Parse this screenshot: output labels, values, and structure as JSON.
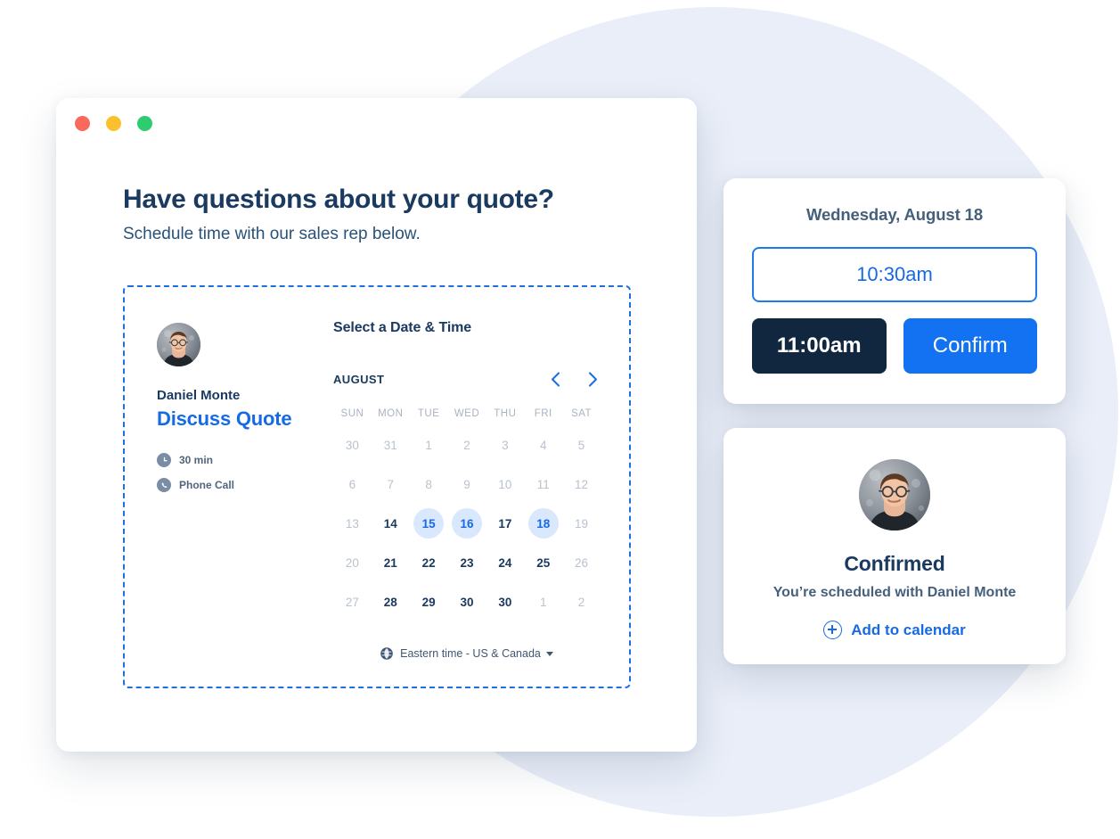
{
  "window": {
    "dots": [
      "close-red",
      "minimize-yellow",
      "maximize-green"
    ]
  },
  "header": {
    "title": "Have questions about your quote?",
    "subtitle": "Schedule time with our sales rep below."
  },
  "scheduler": {
    "rep": {
      "name": "Daniel Monte",
      "meeting_title": "Discuss Quote",
      "meta": [
        {
          "icon": "clock-icon",
          "label": "30 min"
        },
        {
          "icon": "phone-icon",
          "label": "Phone Call"
        }
      ]
    },
    "calendar": {
      "heading": "Select a Date & Time",
      "month": "AUGUST",
      "prev_arrow": "chevron-left-icon",
      "next_arrow": "chevron-right-icon",
      "weekdays": [
        "SUN",
        "MON",
        "TUE",
        "WED",
        "THU",
        "FRI",
        "SAT"
      ],
      "weeks": [
        [
          {
            "day": "30",
            "state": "muted"
          },
          {
            "day": "31",
            "state": "muted"
          },
          {
            "day": "1",
            "state": "muted"
          },
          {
            "day": "2",
            "state": "muted"
          },
          {
            "day": "3",
            "state": "muted"
          },
          {
            "day": "4",
            "state": "muted"
          },
          {
            "day": "5",
            "state": "muted"
          }
        ],
        [
          {
            "day": "6",
            "state": "muted"
          },
          {
            "day": "7",
            "state": "muted"
          },
          {
            "day": "8",
            "state": "muted"
          },
          {
            "day": "9",
            "state": "muted"
          },
          {
            "day": "10",
            "state": "muted"
          },
          {
            "day": "11",
            "state": "muted"
          },
          {
            "day": "12",
            "state": "muted"
          }
        ],
        [
          {
            "day": "13",
            "state": "muted"
          },
          {
            "day": "14",
            "state": "normal"
          },
          {
            "day": "15",
            "state": "available"
          },
          {
            "day": "16",
            "state": "available"
          },
          {
            "day": "17",
            "state": "normal"
          },
          {
            "day": "18",
            "state": "available"
          },
          {
            "day": "19",
            "state": "muted"
          }
        ],
        [
          {
            "day": "20",
            "state": "muted"
          },
          {
            "day": "21",
            "state": "normal"
          },
          {
            "day": "22",
            "state": "normal"
          },
          {
            "day": "23",
            "state": "normal"
          },
          {
            "day": "24",
            "state": "normal"
          },
          {
            "day": "25",
            "state": "normal"
          },
          {
            "day": "26",
            "state": "muted"
          }
        ],
        [
          {
            "day": "27",
            "state": "muted"
          },
          {
            "day": "28",
            "state": "normal"
          },
          {
            "day": "29",
            "state": "normal"
          },
          {
            "day": "30",
            "state": "normal"
          },
          {
            "day": "30",
            "state": "normal"
          },
          {
            "day": "1",
            "state": "muted"
          },
          {
            "day": "2",
            "state": "muted"
          }
        ]
      ],
      "timezone": {
        "icon": "globe-icon",
        "label": "Eastern time - US & Canada",
        "caret": "caret-down-icon"
      }
    }
  },
  "timeslot_card": {
    "date": "Wednesday, August 18",
    "selected_slot": "10:30am",
    "alternate_slot": "11:00am",
    "confirm_label": "Confirm"
  },
  "confirmation_card": {
    "avatar": "avatar",
    "heading": "Confirmed",
    "subtext": "You’re scheduled with Daniel Monte",
    "add_to_calendar": {
      "icon": "plus-circle-icon",
      "label": "Add to calendar"
    }
  },
  "colors": {
    "brand_blue": "#176ae5",
    "button_blue": "#1272f2",
    "dark_navy": "#11263f",
    "heading_navy": "#1b3a60",
    "available_bg": "#d9e8fc",
    "muted_text": "#b9c2cf",
    "background_circle": "#e9eef8",
    "dot_red": "#f96a5d",
    "dot_yellow": "#fbc02d",
    "dot_green": "#2ecc71"
  }
}
